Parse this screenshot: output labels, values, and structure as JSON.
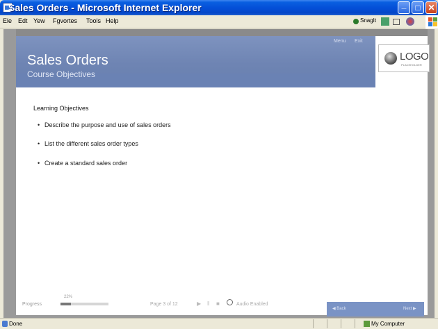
{
  "window": {
    "title": "Sales Orders - Microsoft Internet Explorer"
  },
  "menu": {
    "items": [
      "Ele",
      "Edt",
      "Yew",
      "Fgvortes",
      "Tools",
      "Help"
    ]
  },
  "toolbar": {
    "snagit_label": "SnagIt"
  },
  "course": {
    "header_links": [
      "Menu",
      "Exit"
    ],
    "title": "Sales Orders",
    "subtitle": "Course Objectives",
    "logo_text": "LOGO",
    "logo_tagline": "PLACEHOLDER"
  },
  "objectives": {
    "heading": "Learning Objectives",
    "items": [
      "Describe the purpose and use of sales orders",
      "List the different sales order types",
      "Create a standard sales order"
    ]
  },
  "footer": {
    "progress_label": "Progress",
    "progress_pct_text": "22%",
    "progress_value": 0.22,
    "page_label": "Page 3 of 12",
    "audio_label": "Audio Enabled",
    "back_label": "◀ Back",
    "next_label": "Next ▶"
  },
  "status": {
    "left_text": "Done",
    "zone_text": "My Computer"
  }
}
